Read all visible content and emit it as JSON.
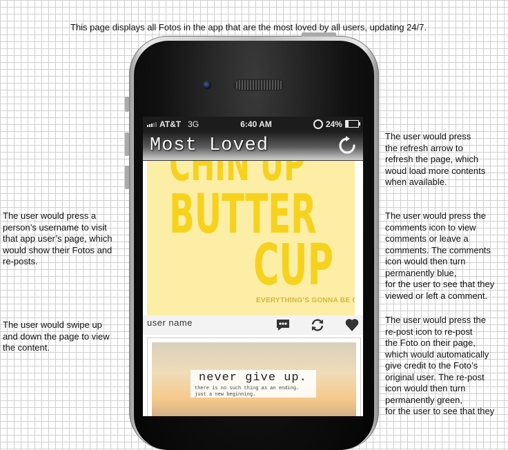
{
  "annotations": {
    "top": "This page displays all Fotos in the app that are the most loved by all users, updating 24/7.",
    "refresh": "The user would press\nthe refresh arrow to\nrefresh the page, which\nwoud load more contents\nwhen available.",
    "comments": "The user would press the\ncomments icon to view\ncomments or leave a\ncomments.  The comments\nicon would then turn\npermanently blue,\nfor the user to see that they\nviewed or left a comment.",
    "repost": "The user would press the\nre-post icon to re-post\nthe Foto on their page,\nwhich would automatically\ngive credit to the Foto’s\noriginal user.  The re-post\nicon would then turn\npermanently green,\nfor the user to see that they",
    "username": "The user would press a\nperson’s username to visit\nthat app user’s page, which\nwould show their Fotos and\nre-posts.",
    "swipe": "The user would swipe up\nand down the page to view\nthe content."
  },
  "status_bar": {
    "carrier": "AT&T",
    "network": "3G",
    "time": "6:40 AM",
    "battery": "24%",
    "battery_level": 0.24
  },
  "nav": {
    "title": "Most Loved",
    "refresh_icon": "refresh-icon"
  },
  "post1": {
    "image_text": {
      "line1": "CHIN UP",
      "line2": "BUTTER",
      "line3": "CUP",
      "tagline": "EVERYTHING'S GONNA BE OK"
    },
    "username": "user name",
    "icons": [
      "comment-icon",
      "repost-icon",
      "heart-icon"
    ]
  },
  "post2": {
    "quote": "never give up.",
    "subquote": "there is no such thing as an ending.\njust a new beginning."
  },
  "colors": {
    "poster_yellow": "#f7d21d",
    "poster_bg": "#fdeea6",
    "nav_dark": "#1a1a1a"
  }
}
